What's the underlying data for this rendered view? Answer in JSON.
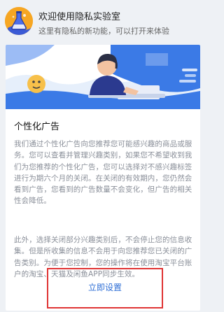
{
  "header": {
    "title": "欢迎使用隐私实验室",
    "subtitle": "这里有隐私的新功能，可以打开来体验"
  },
  "card": {
    "section_title": "个性化广告",
    "paragraph1": "我们通过个性化广告向您推荐您可能感兴趣的商品或服务。您可以查看并管理兴趣类别，如果您不希望收到我们为您推荐的个性化广告，您可以选择对不感兴趣标签进行为期六个月的关闭。在关闭的有效期内，您仍然会看到广告，您看到的广告数量不会变化，但广告的相关性会降低。",
    "paragraph2": "此外，选择关闭部分兴趣类别后，不会停止您的信息收集。但是所收集的信息不会用于向您推荐您已关闭的广告类别。为便于您控制，您的操作将在使用淘宝平台账户的淘宝、天猫及闲鱼APP同步生效。",
    "cta_label": "立即设置"
  },
  "colors": {
    "accent": "#2f6fd6",
    "banner_blue": "#3b7ae6",
    "highlight_border": "#e03535",
    "icon_bg": "#f6a623"
  }
}
